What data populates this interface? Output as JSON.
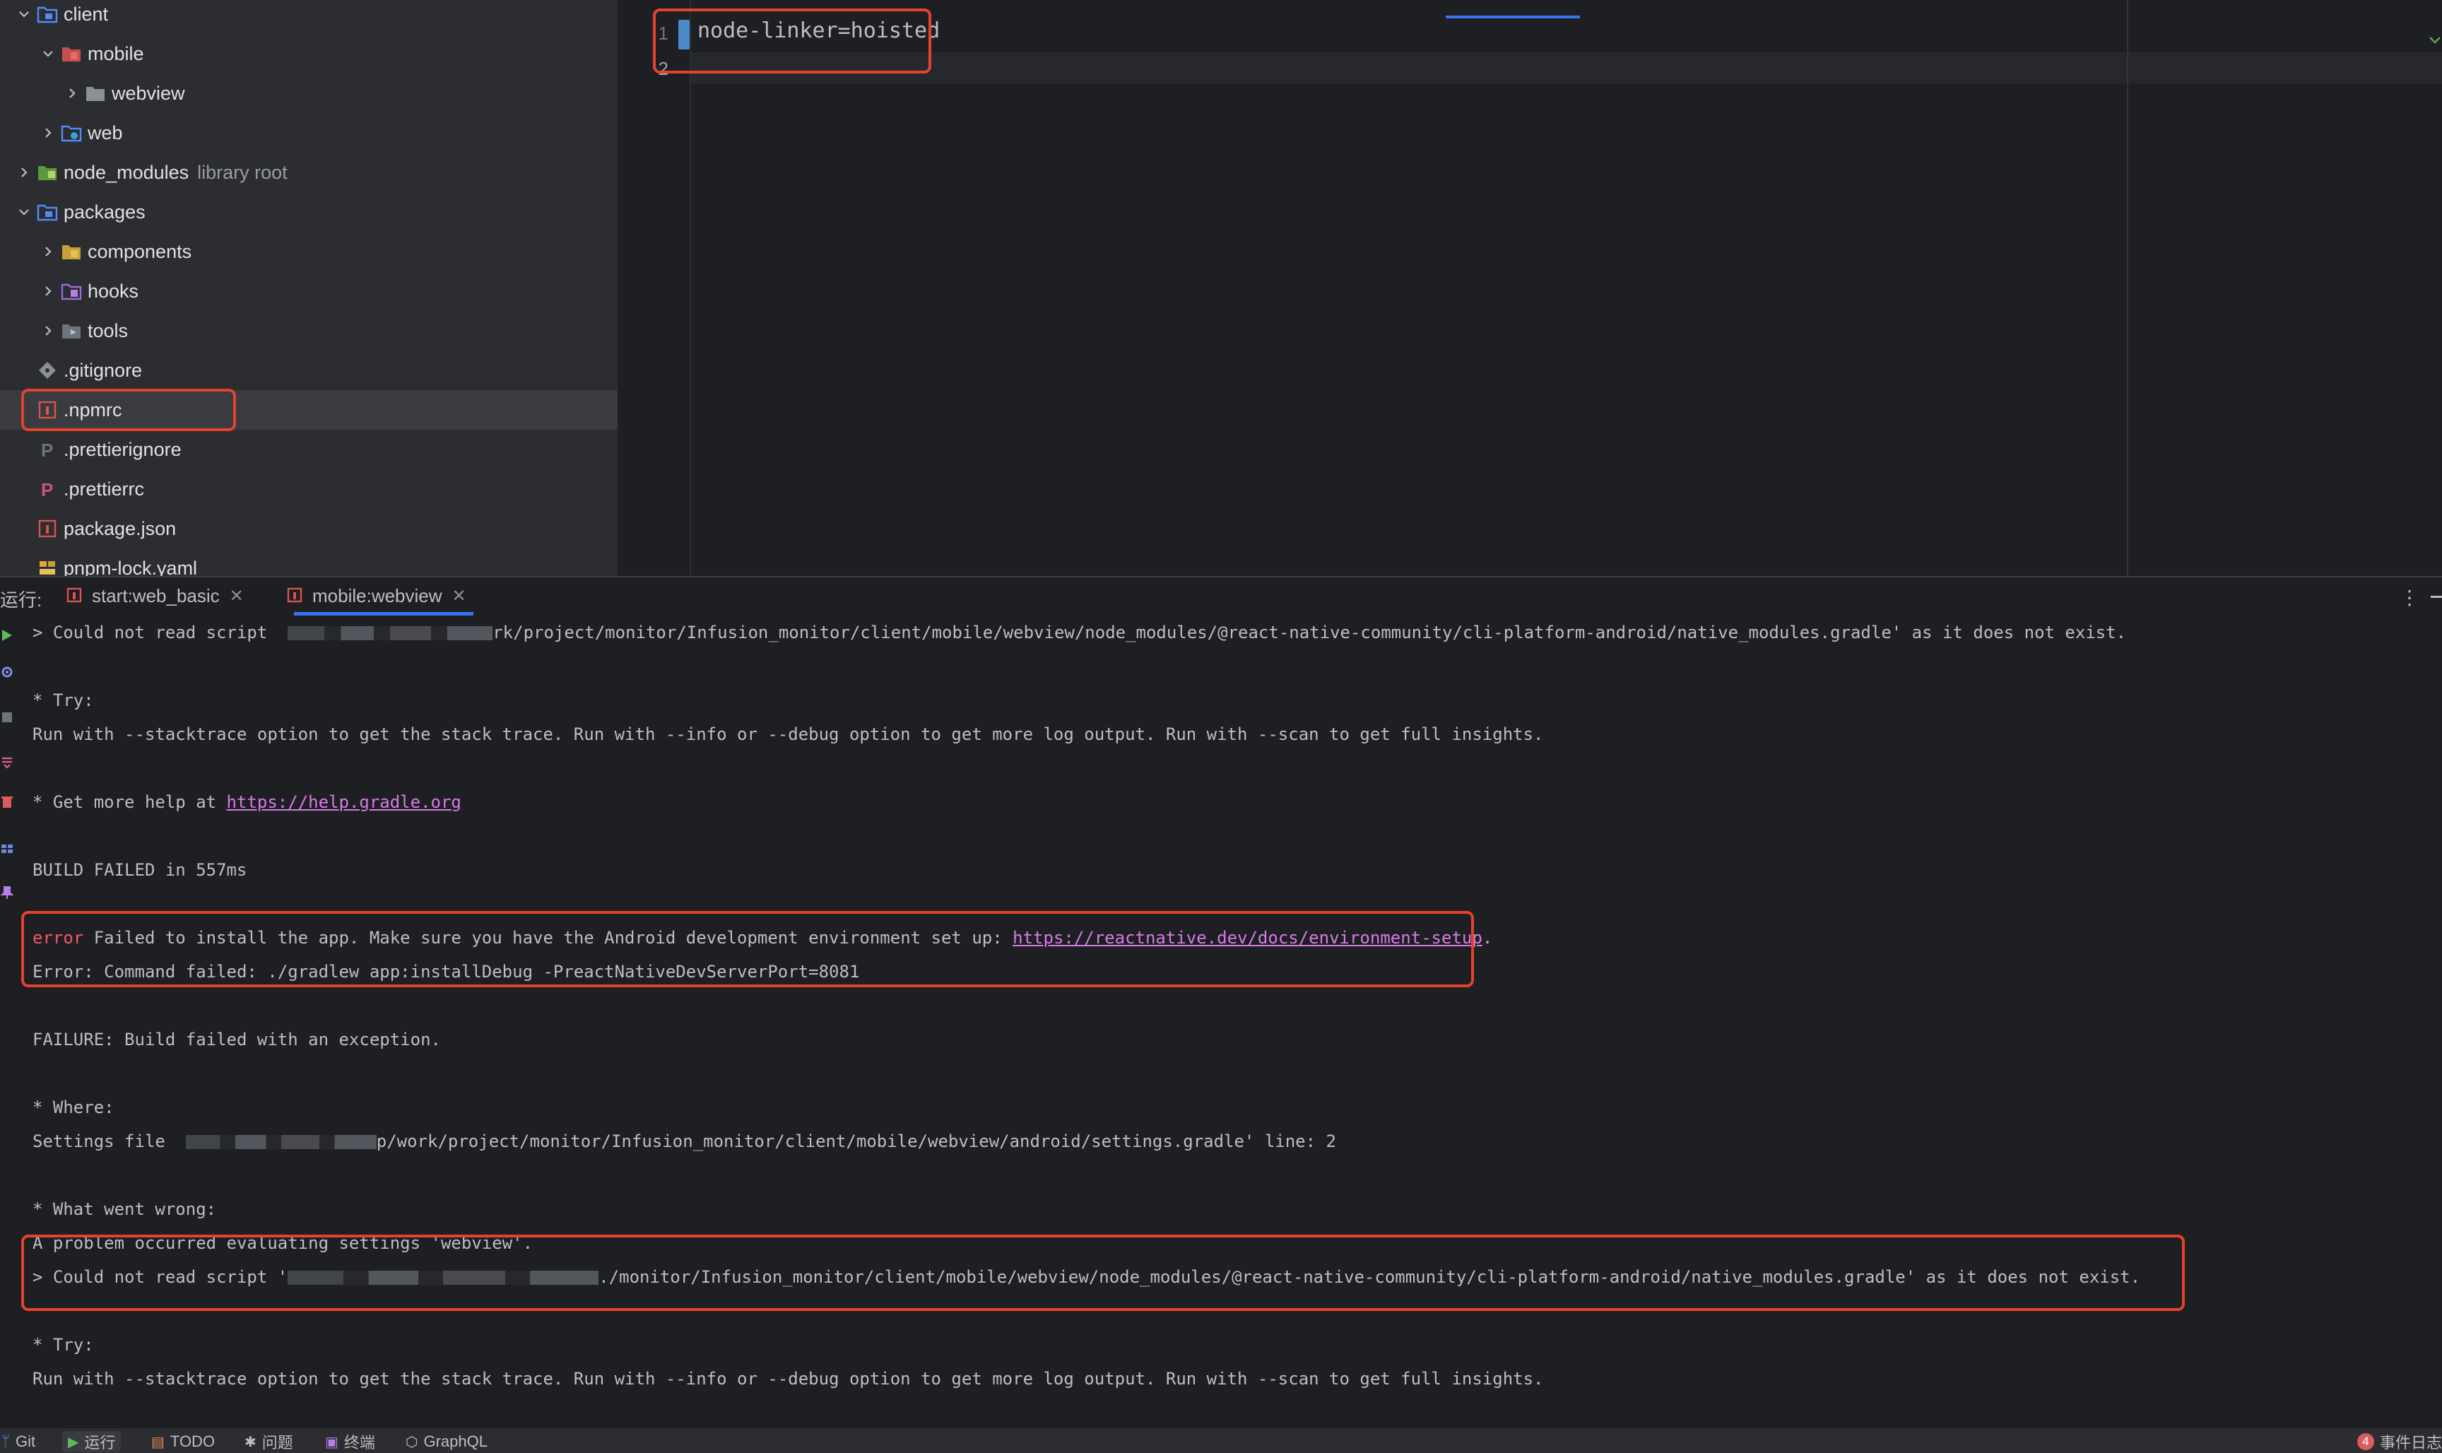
{
  "project_tree": {
    "items": [
      {
        "label": "client",
        "expanded": true,
        "icon": "module-folder-icon"
      },
      {
        "label": "mobile",
        "expanded": true,
        "icon": "module-folder-icon"
      },
      {
        "label": "webview",
        "expanded": false,
        "icon": "folder-icon"
      },
      {
        "label": "web",
        "expanded": false,
        "icon": "module-folder-icon"
      },
      {
        "label": "node_modules",
        "suffix": "library root",
        "expanded": false,
        "icon": "library-folder-icon"
      },
      {
        "label": "packages",
        "expanded": true,
        "icon": "module-folder-icon"
      },
      {
        "label": "components",
        "expanded": false,
        "icon": "module-folder-icon"
      },
      {
        "label": "hooks",
        "expanded": false,
        "icon": "module-folder-icon"
      },
      {
        "label": "tools",
        "expanded": false,
        "icon": "module-folder-icon"
      },
      {
        "label": ".gitignore",
        "icon": "git-file-icon"
      },
      {
        "label": ".npmrc",
        "icon": "npm-file-icon",
        "selected": true
      },
      {
        "label": ".prettierignore",
        "icon": "prettier-file-icon"
      },
      {
        "label": ".prettierrc",
        "icon": "prettier-file-icon"
      },
      {
        "label": "package.json",
        "icon": "npm-file-icon"
      },
      {
        "label": "pnpm-lock.yaml",
        "icon": "yaml-file-icon"
      }
    ]
  },
  "editor": {
    "line_numbers": [
      "1",
      "2"
    ],
    "lines": [
      "node-linker=hoisted",
      ""
    ]
  },
  "run_panel": {
    "label": "运行:",
    "tabs": [
      {
        "label": "start:web_basic",
        "active": false
      },
      {
        "label": "mobile:webview",
        "active": true
      }
    ],
    "console": [
      {
        "type": "redacted",
        "prefix": "> Could not read script  ",
        "suffix": "rk/project/monitor/Infusion_monitor/client/mobile/webview/node_modules/@react-native-community/cli-platform-android/native_modules.gradle' as it does not exist."
      },
      {
        "type": "text",
        "text": "* Try:"
      },
      {
        "type": "text",
        "text": "Run with --stacktrace option to get the stack trace. Run with --info or --debug option to get more log output. Run with --scan to get full insights."
      },
      {
        "type": "link",
        "prefix": "* Get more help at ",
        "link": "https://help.gradle.org",
        "suffix": ""
      },
      {
        "type": "text",
        "text": "BUILD FAILED in 557ms"
      },
      {
        "type": "error",
        "keyword": "error",
        "prefix": " Failed to install the app. Make sure you have the Android development environment set up: ",
        "link": "https://reactnative.dev/docs/environment-setup",
        "suffix": "."
      },
      {
        "type": "text",
        "text": "Error: Command failed: ./gradlew app:installDebug -PreactNativeDevServerPort=8081"
      },
      {
        "type": "text",
        "text": "FAILURE: Build failed with an exception."
      },
      {
        "type": "text",
        "text": "* Where:"
      },
      {
        "type": "redacted",
        "prefix": "Settings file  ",
        "suffix": "p/work/project/monitor/Infusion_monitor/client/mobile/webview/android/settings.gradle' line: 2"
      },
      {
        "type": "text",
        "text": "* What went wrong:"
      },
      {
        "type": "text",
        "text": "A problem occurred evaluating settings 'webview'."
      },
      {
        "type": "redacted",
        "prefix": "> Could not read script '",
        "suffix": "./monitor/Infusion_monitor/client/mobile/webview/node_modules/@react-native-community/cli-platform-android/native_modules.gradle' as it does not exist."
      },
      {
        "type": "text",
        "text": "* Try:"
      },
      {
        "type": "text",
        "text": "Run with --stacktrace option to get the stack trace. Run with --info or --debug option to get more log output. Run with --scan to get full insights."
      }
    ]
  },
  "statusbar": {
    "items": [
      {
        "label": "Git",
        "icon": "git-branch-icon"
      },
      {
        "label": "运行",
        "icon": "run-icon",
        "active": true
      },
      {
        "label": "TODO",
        "icon": "todo-icon"
      },
      {
        "label": "问题",
        "icon": "problems-icon"
      },
      {
        "label": "终端",
        "icon": "terminal-icon"
      },
      {
        "label": "GraphQL",
        "icon": "graphql-icon"
      }
    ],
    "event_log": {
      "count": "4",
      "label": "事件日志"
    }
  },
  "colors": {
    "highlight_box": "#e5422c",
    "error_text": "#f75464",
    "link_text": "#d77ae6",
    "accent": "#3574f0"
  }
}
